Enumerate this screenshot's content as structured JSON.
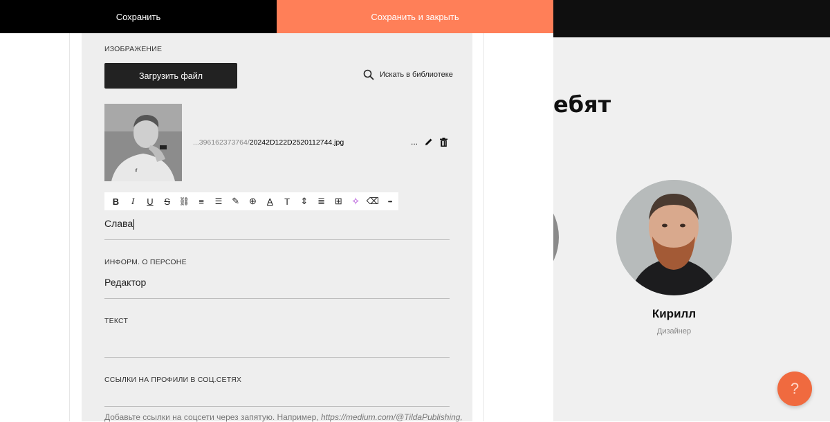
{
  "header": {
    "save_label": "Сохранить",
    "save_close_label": "Сохранить и закрыть"
  },
  "image_section": {
    "label": "ИЗОБРАЖЕНИЕ",
    "upload_label": "Загрузить файл",
    "search_label": "Искать в библиотеке",
    "file_prefix": "...396162373764/",
    "file_name": "20242D122D2520112744.jpg",
    "more_label": "...",
    "icons": [
      "search-icon",
      "pencil-icon",
      "trash-icon"
    ]
  },
  "toolbar": {
    "items": [
      {
        "name": "bold-icon",
        "glyph": "B"
      },
      {
        "name": "italic-icon",
        "glyph": "I"
      },
      {
        "name": "underline-icon",
        "glyph": "U"
      },
      {
        "name": "strikethrough-icon",
        "glyph": "S"
      },
      {
        "name": "link-icon",
        "glyph": "⛓"
      },
      {
        "name": "ordered-list-icon",
        "glyph": "≡"
      },
      {
        "name": "bullet-list-icon",
        "glyph": "☰"
      },
      {
        "name": "highlight-icon",
        "glyph": "✎"
      },
      {
        "name": "globe-icon",
        "glyph": "⊕"
      },
      {
        "name": "font-color-icon",
        "glyph": "A"
      },
      {
        "name": "font-size-icon",
        "glyph": "T"
      },
      {
        "name": "line-height-icon",
        "glyph": "⇕"
      },
      {
        "name": "align-icon",
        "glyph": "≣"
      },
      {
        "name": "book-icon",
        "glyph": "⊞"
      },
      {
        "name": "ai-sparkle-icon",
        "glyph": "✧"
      },
      {
        "name": "eraser-icon",
        "glyph": "⌫"
      },
      {
        "name": "more-icon",
        "glyph": "•••"
      }
    ]
  },
  "fields": {
    "name_value": "Слава",
    "info_label": "ИНФОРМ. О ПЕРСОНЕ",
    "info_value": "Редактор",
    "text_label": "ТЕКСТ",
    "social_label": "ССЫЛКИ НА ПРОФИЛИ В СОЦ.СЕТЯХ",
    "hint_text": "Добавьте ссылки на соцсети через запятую. Например, ",
    "hint_example": "https://medium.com/@TildaPublishing,"
  },
  "site_preview": {
    "heading_partial": "ебят",
    "member_name": "Кирилл",
    "member_role": "Дизайнер",
    "help_label": "?"
  },
  "colors": {
    "accent": "#ff7f58",
    "help_button": "#f06a3f",
    "dark": "#000000",
    "ai_sparkle": "#b14fd8"
  }
}
